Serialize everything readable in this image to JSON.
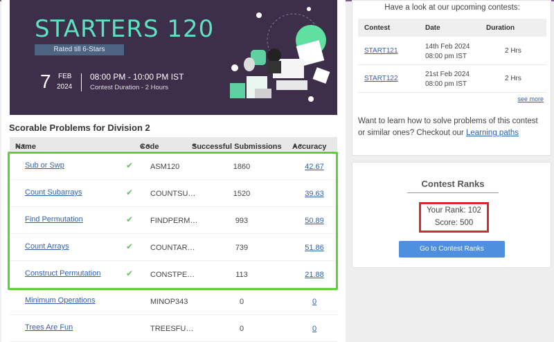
{
  "banner": {
    "title": "STARTERS 120",
    "rated": "Rated till 6-Stars",
    "day": "7",
    "month": "FEB",
    "year": "2024",
    "time": "08:00 PM - 10:00 PM IST",
    "duration": "Contest Duration - 2  Hours"
  },
  "problems": {
    "section_title": "Scorable Problems for Division 2",
    "headers": {
      "name": "Name",
      "code": "Code",
      "submissions": "Successful Submissions",
      "accuracy": "Accuracy"
    },
    "rows": [
      {
        "name": "Sub or Swp",
        "code": "ASM120",
        "submissions": "1860",
        "accuracy": "42.67",
        "solved": true
      },
      {
        "name": "Count Subarrays",
        "code": "COUNTSU…",
        "submissions": "1520",
        "accuracy": "39.63",
        "solved": true
      },
      {
        "name": "Find Permutation",
        "code": "FINDPERM…",
        "submissions": "993",
        "accuracy": "50.89",
        "solved": true
      },
      {
        "name": "Count Arrays",
        "code": "COUNTAR…",
        "submissions": "739",
        "accuracy": "51.86",
        "solved": true
      },
      {
        "name": "Construct Permutation",
        "code": "CONSTPE…",
        "submissions": "113",
        "accuracy": "21.88",
        "solved": true
      },
      {
        "name": "Minimum Operations",
        "code": "MINOP343",
        "submissions": "0",
        "accuracy": "0",
        "solved": false
      },
      {
        "name": "Trees Are Fun",
        "code": "TREESFU…",
        "submissions": "0",
        "accuracy": "0",
        "solved": false
      }
    ]
  },
  "upcoming": {
    "title": "Have a look at our upcoming contests:",
    "headers": {
      "contest": "Contest",
      "date": "Date",
      "duration": "Duration"
    },
    "rows": [
      {
        "contest": "START121",
        "date": "14th Feb 2024",
        "time": "08:00 pm IST",
        "duration": "2 Hrs"
      },
      {
        "contest": "START122",
        "date": "21st Feb 2024",
        "time": "08:00 pm IST",
        "duration": "2 Hrs"
      }
    ],
    "see_more": "see more",
    "learn_text": "Want to learn how to solve problems of this contest or similar ones? Checkout our",
    "learn_link": "Learning paths"
  },
  "ranks": {
    "title": "Contest Ranks",
    "your_rank": "Your Rank: 102",
    "score": "Score: 500",
    "button": "Go to Contest Ranks"
  },
  "colors": {
    "banner_bg": "#3d2e4a",
    "banner_title": "#5fe0c0",
    "link": "#2f5fa8",
    "check": "#6ac06a",
    "highlight_green": "#5cd03a",
    "highlight_red": "#d42a2a",
    "button": "#4f8fe0"
  },
  "icons": {
    "solved": "check-icon",
    "sort": "sort-icon"
  }
}
